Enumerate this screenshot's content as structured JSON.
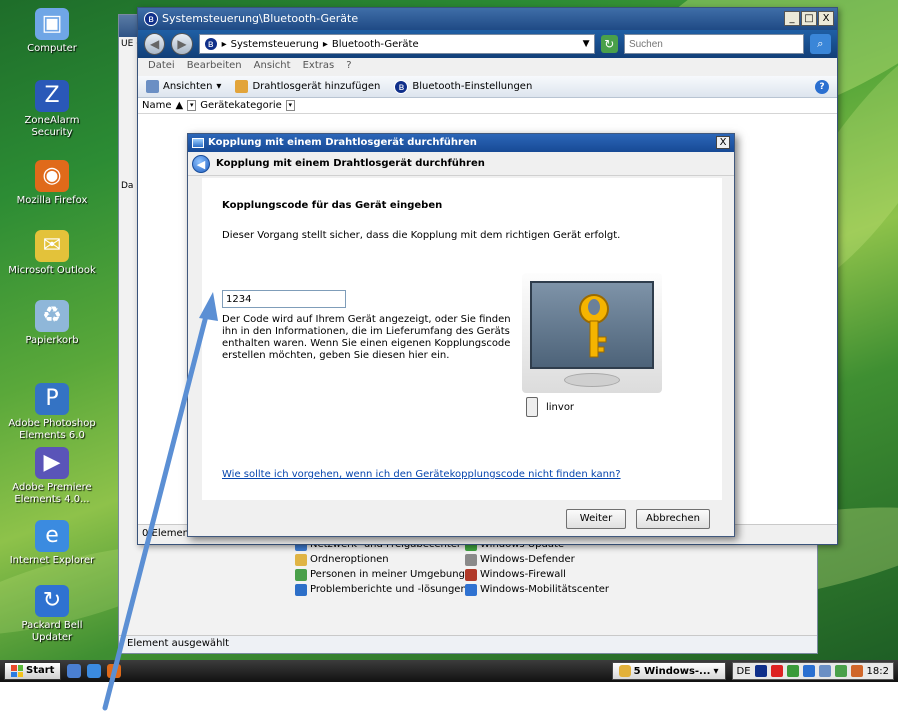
{
  "desktop": {
    "icons": [
      {
        "label": "Computer",
        "icon": "computer-icon",
        "color": "#6fa6e6"
      },
      {
        "label": "ZoneAlarm Security",
        "icon": "zonealarm-icon",
        "color": "#2a58b8"
      },
      {
        "label": "Mozilla Firefox",
        "icon": "firefox-icon",
        "color": "#e06a1a"
      },
      {
        "label": "Microsoft Outlook",
        "icon": "outlook-icon",
        "color": "#e3c23a"
      },
      {
        "label": "Papierkorb",
        "icon": "recycle-bin-icon",
        "color": "#8fb7d9"
      },
      {
        "label": "Adobe Photoshop Elements 6.0",
        "icon": "photoshop-icon",
        "color": "#3473c4"
      },
      {
        "label": "Adobe Premiere Elements 4.0...",
        "icon": "premiere-icon",
        "color": "#5a54b8"
      },
      {
        "label": "Internet Explorer",
        "icon": "internet-explorer-icon",
        "color": "#3b8be0"
      },
      {
        "label": "Packard Bell Updater",
        "icon": "updater-icon",
        "color": "#2f72d1"
      }
    ]
  },
  "back_window": {
    "status": "Element ausgewählt",
    "left_fragment": "UE (P",
    "left_fragment2": "Da",
    "control_panel": {
      "col1": [
        {
          "label": "Netzwerk- und Freigabecenter",
          "icon": "network-icon",
          "color": "#3d7bd1"
        },
        {
          "label": "Ordneroptionen",
          "icon": "folder-options-icon",
          "color": "#e0b444"
        },
        {
          "label": "Personen in meiner Umgebung",
          "icon": "people-icon",
          "color": "#4aa04a"
        },
        {
          "label": "Problemberichte und -lösungen",
          "icon": "problem-reports-icon",
          "color": "#2d6fc8"
        }
      ],
      "col2": [
        {
          "label": "Windows Update",
          "icon": "windows-update-icon",
          "color": "#3fa43f"
        },
        {
          "label": "Windows-Defender",
          "icon": "defender-icon",
          "color": "#8a8a8a"
        },
        {
          "label": "Windows-Firewall",
          "icon": "firewall-icon",
          "color": "#b13a2a"
        },
        {
          "label": "Windows-Mobilitätscenter",
          "icon": "mobility-center-icon",
          "color": "#2f72d1"
        }
      ]
    }
  },
  "main_window": {
    "title": "Systemsteuerung\\Bluetooth-Geräte",
    "controls": {
      "minimize": "_",
      "maximize": "□",
      "close": "X"
    },
    "breadcrumb": [
      "Systemsteuerung",
      "Bluetooth-Geräte"
    ],
    "search_placeholder": "Suchen",
    "menu": [
      "Datei",
      "Bearbeiten",
      "Ansicht",
      "Extras",
      "?"
    ],
    "toolbar": {
      "views": "Ansichten",
      "add_device": "Drahtlosgerät hinzufügen",
      "bt_settings": "Bluetooth-Einstellungen"
    },
    "columns": {
      "name": "Name",
      "category": "Gerätekategorie"
    },
    "status": "0 Elemente"
  },
  "dialog": {
    "title": "Kopplung mit einem Drahtlosgerät durchführen",
    "header": "Kopplung mit einem Drahtlosgerät durchführen",
    "heading": "Kopplungscode für das Gerät eingeben",
    "description": "Dieser Vorgang stellt sicher, dass die Kopplung mit dem richtigen Gerät erfolgt.",
    "code_value": "1234",
    "help_text": "Der Code wird auf Ihrem Gerät angezeigt, oder Sie finden ihn in den Informationen, die im Lieferumfang des Geräts enthalten waren. Wenn Sie einen eigenen Kopplungscode erstellen möchten, geben Sie diesen hier ein.",
    "device_name": "linvor",
    "help_link": "Wie sollte ich vorgehen, wenn ich den Gerätekopplungscode nicht finden kann?",
    "buttons": {
      "next": "Weiter",
      "cancel": "Abbrechen"
    }
  },
  "taskbar": {
    "start": "Start",
    "task_button": "5 Windows-...",
    "language": "DE",
    "clock": "18:2"
  },
  "colors": {
    "accent_blue": "#1f4a85",
    "link": "#0645ad",
    "annotation_arrow": "#5b8fd4"
  }
}
